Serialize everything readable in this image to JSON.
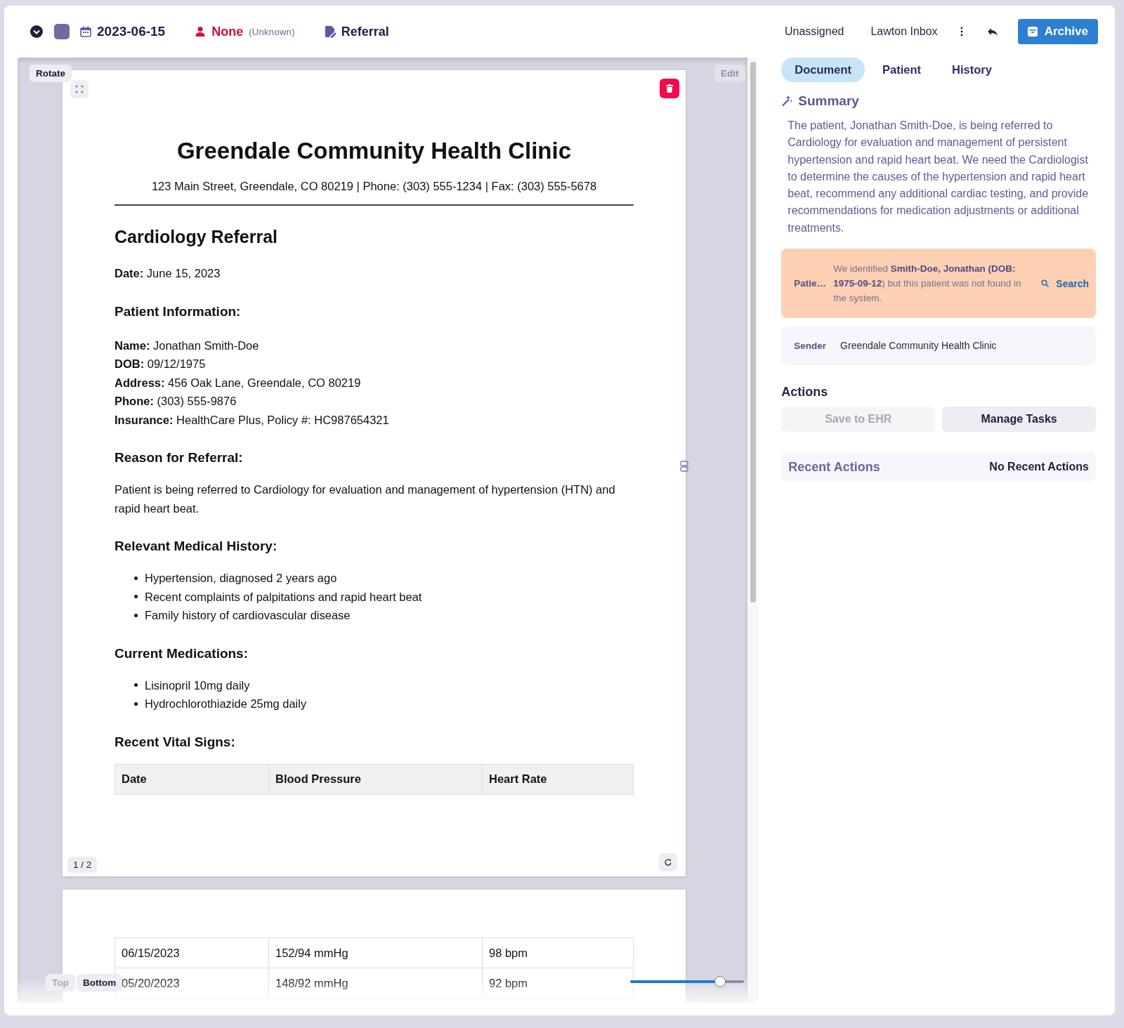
{
  "toolbar": {
    "date": "2023-06-15",
    "patient": "None",
    "patient_note": "(Unknown)",
    "doc_type": "Referral",
    "assignee": "Unassigned",
    "inbox": "Lawton Inbox",
    "archive_button": "Archive"
  },
  "viewer": {
    "rotate_button": "Rotate",
    "edit_button": "Edit",
    "page_indicator": "1 / 2",
    "nav_buttons": [
      {
        "label": "Top",
        "disabled": true
      },
      {
        "label": "Bottom",
        "disabled": false
      }
    ],
    "zoom": {
      "level": 0.79
    },
    "pages": [
      {
        "blocks": [
          {
            "kind": "clinic",
            "name": "Greendale Community Health Clinic",
            "address": "123 Main Street, Greendale, CO 80219 | Phone: (303) 555-1234 | Fax: (303) 555-5678"
          },
          {
            "kind": "title",
            "text": "Cardiology Referral"
          },
          {
            "kind": "lines",
            "lines": [
              "**Date:** June 15, 2023"
            ]
          },
          {
            "kind": "heading",
            "text": "Patient Information:"
          },
          {
            "kind": "lines",
            "lines": [
              "**Name:** Jonathan Smith-Doe",
              "**DOB:** 09/12/1975",
              "**Address:** 456 Oak Lane, Greendale, CO 80219",
              "**Phone:** (303) 555-9876",
              "**Insurance:** HealthCare Plus, Policy #: HC987654321"
            ]
          },
          {
            "kind": "heading",
            "text": "Reason for Referral:"
          },
          {
            "kind": "paragraph",
            "text": "Patient is being referred to Cardiology for evaluation and management of hypertension (HTN) and rapid heart beat."
          },
          {
            "kind": "heading",
            "text": "Relevant Medical History:"
          },
          {
            "kind": "bullets",
            "items": [
              "Hypertension, diagnosed 2 years ago",
              "Recent complaints of palpitations and rapid heart beat",
              "Family history of cardiovascular disease"
            ]
          },
          {
            "kind": "heading",
            "text": "Current Medications:"
          },
          {
            "kind": "bullets",
            "items": [
              "Lisinopril 10mg daily",
              "Hydrochlorothiazide 25mg daily"
            ]
          },
          {
            "kind": "heading",
            "text": "Recent Vital Signs:"
          },
          {
            "kind": "table",
            "columns": [
              "Date",
              "Blood Pressure",
              "Heart Rate"
            ]
          }
        ]
      },
      {
        "blocks": [
          {
            "kind": "table",
            "rows": [
              [
                "06/15/2023",
                "152/94 mmHg",
                "98 bpm"
              ],
              [
                "05/20/2023",
                "148/92 mmHg",
                "92 bpm"
              ]
            ]
          }
        ]
      }
    ]
  },
  "tabs": [
    {
      "label": "Document",
      "selected": true
    },
    {
      "label": "Patient",
      "selected": false
    },
    {
      "label": "History",
      "selected": false
    }
  ],
  "summary": {
    "title": "Summary",
    "text": "The patient, Jonathan Smith-Doe, is being referred to Cardiology for evaluation and management of persistent hypertension and rapid heart beat. We need the Cardiologist to determine the causes of the hypertension and rapid heart beat, recommend any additional cardiac testing, and provide recommendations for medication adjustments or additional treatments."
  },
  "alert": {
    "label": "Patie…",
    "message": "We identified **Smith-Doe, Jonathan (DOB: 1975-09-12**) but this patient was not found in the system.",
    "action": "Search"
  },
  "sender": {
    "label": "Sender",
    "value": "Greendale Community Health Clinic"
  },
  "actions": {
    "title": "Actions",
    "buttons": [
      {
        "label": "Save to EHR",
        "disabled": true
      },
      {
        "label": "Manage Tasks",
        "disabled": false
      }
    ]
  },
  "recent_actions": {
    "title": "Recent Actions",
    "value": "No Recent Actions"
  }
}
